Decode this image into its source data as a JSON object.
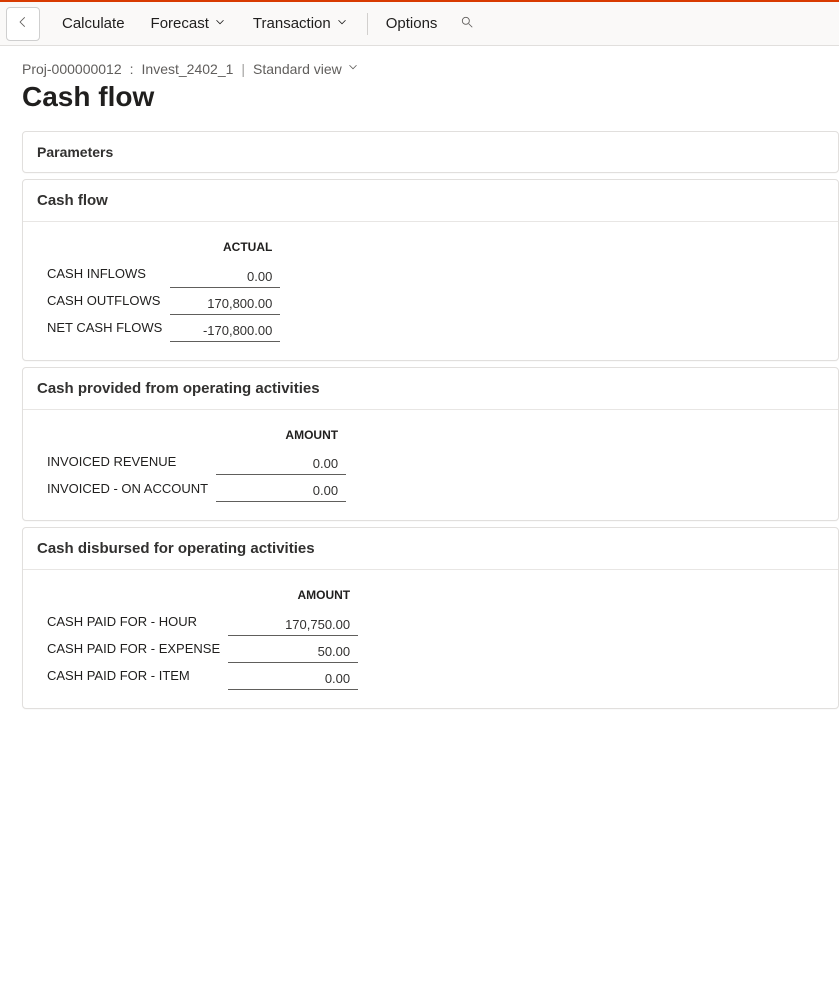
{
  "toolbar": {
    "calculate": "Calculate",
    "forecast": "Forecast",
    "transaction": "Transaction",
    "options": "Options"
  },
  "breadcrumb": {
    "project_id": "Proj-000000012",
    "project_name": "Invest_2402_1",
    "view_label": "Standard view"
  },
  "page_title": "Cash flow",
  "parameters_panel": {
    "title": "Parameters"
  },
  "cash_flow_panel": {
    "title": "Cash flow",
    "col_header": "Actual",
    "rows": [
      {
        "label": "Cash inflows",
        "value": "0.00"
      },
      {
        "label": "Cash outflows",
        "value": "170,800.00"
      },
      {
        "label": "Net cash flows",
        "value": "-170,800.00"
      }
    ]
  },
  "operating_in_panel": {
    "title": "Cash provided from operating activities",
    "col_header": "Amount",
    "rows": [
      {
        "label": "Invoiced revenue",
        "value": "0.00"
      },
      {
        "label": "Invoiced - on account",
        "value": "0.00"
      }
    ]
  },
  "operating_out_panel": {
    "title": "Cash disbursed for operating activities",
    "col_header": "Amount",
    "rows": [
      {
        "label": "Cash paid for - hour",
        "value": "170,750.00"
      },
      {
        "label": "Cash paid for - expense",
        "value": "50.00"
      },
      {
        "label": "Cash paid for - item",
        "value": "0.00"
      }
    ]
  }
}
